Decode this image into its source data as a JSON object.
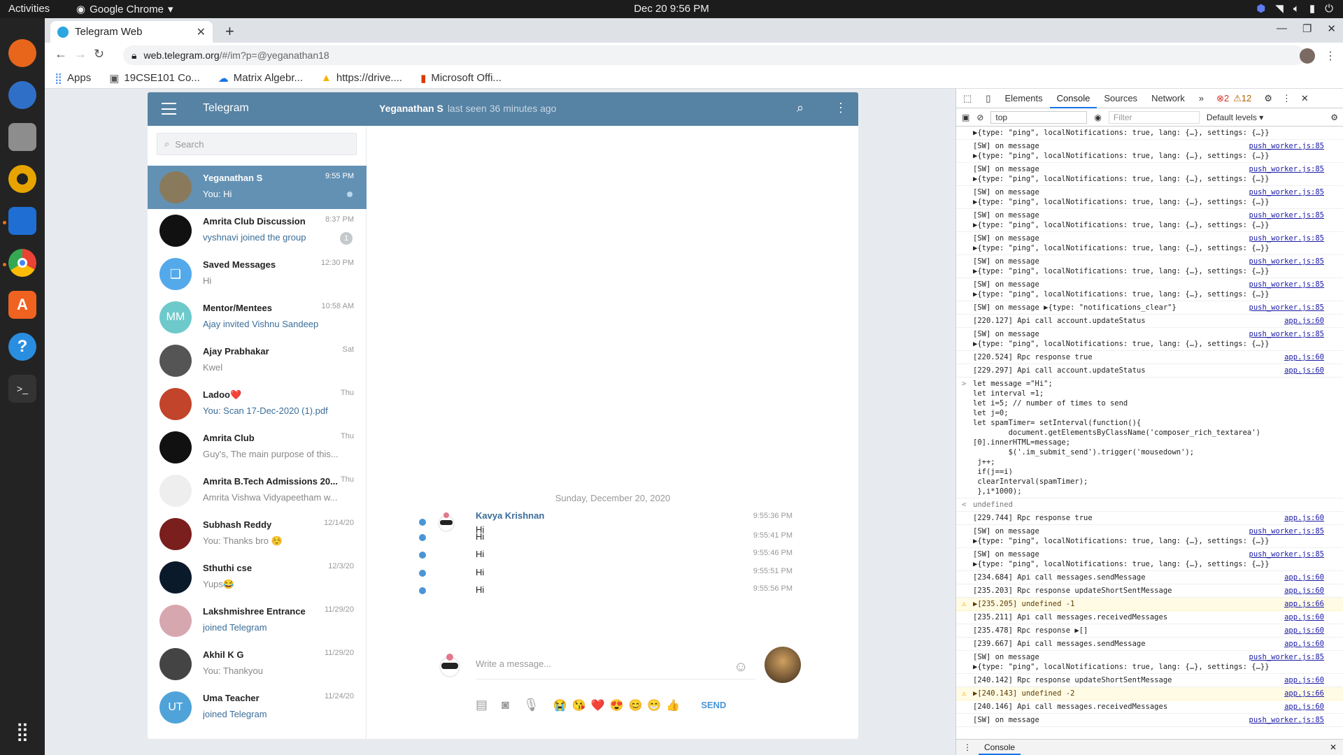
{
  "os": {
    "activities": "Activities",
    "app_name": "Google Chrome",
    "clock": "Dec 20  9:56 PM"
  },
  "dock": [
    "firefox-icon",
    "thunderbird-icon",
    "files-icon",
    "rhythmbox-icon",
    "writer-icon",
    "chrome-icon",
    "software-icon",
    "help-icon",
    "terminal-icon",
    "app-grid-icon"
  ],
  "browser": {
    "tab_title": "Telegram Web",
    "url_host": "web.telegram.org",
    "url_path": "/#/im?p=@yeganathan18",
    "bookmarks": [
      "Apps",
      "19CSE101 Co...",
      "Matrix Algebr...",
      "https://drive....",
      "Microsoft Offi..."
    ]
  },
  "telegram": {
    "brand": "Telegram",
    "peer_name": "Yeganathan S",
    "peer_status": "last seen 36 minutes ago",
    "search_placeholder": "Search",
    "dialogs": [
      {
        "name": "Yeganathan S",
        "time": "9:55 PM",
        "msg": "You: Hi",
        "active": true
      },
      {
        "name": "Amrita Club Discussion",
        "time": "8:37 PM",
        "msg": "vyshnavi joined the group",
        "badge": "1",
        "blue": true
      },
      {
        "name": "Saved Messages",
        "time": "12:30 PM",
        "msg": "Hi"
      },
      {
        "name": "Mentor/Mentees",
        "time": "10:58 AM",
        "msg": "Ajay invited Vishnu Sandeep",
        "initials": "MM",
        "blue": true
      },
      {
        "name": "Ajay Prabhakar",
        "time": "Sat",
        "msg": "Kwel"
      },
      {
        "name": "Ladoo❤️",
        "time": "Thu",
        "msg": "You: Scan 17-Dec-2020 (1).pdf",
        "blue": true
      },
      {
        "name": "Amrita Club",
        "time": "Thu",
        "msg": "Guy's, The main purpose of this..."
      },
      {
        "name": "Amrita B.Tech Admissions 20...",
        "time": "Thu",
        "msg": "Amrita Vishwa Vidyapeetham w..."
      },
      {
        "name": "Subhash Reddy",
        "time": "12/14/20",
        "msg": "You: Thanks bro ☺️"
      },
      {
        "name": "Sthuthi cse",
        "time": "12/3/20",
        "msg": "Yups😂"
      },
      {
        "name": "Lakshmishree Entrance",
        "time": "11/29/20",
        "msg": "joined Telegram",
        "blue": true
      },
      {
        "name": "Akhil K G",
        "time": "11/29/20",
        "msg": "You: Thankyou"
      },
      {
        "name": "Uma Teacher",
        "time": "11/24/20",
        "msg": "joined Telegram",
        "initials": "UT",
        "blue": true
      }
    ],
    "date_separator": "Sunday, December 20, 2020",
    "author": "Kavya Krishnan",
    "messages": [
      {
        "text": "Hi",
        "time": "9:55:36 PM"
      },
      {
        "text": "Hi",
        "time": "9:55:41 PM"
      },
      {
        "text": "Hi",
        "time": "9:55:46 PM"
      },
      {
        "text": "Hi",
        "time": "9:55:51 PM"
      },
      {
        "text": "Hi",
        "time": "9:55:56 PM"
      }
    ],
    "composer_placeholder": "Write a message...",
    "send_label": "SEND",
    "quick_emojis": [
      "😭",
      "😘",
      "❤️",
      "😍",
      "😊",
      "😁",
      "👍"
    ]
  },
  "devtools": {
    "tabs": [
      "Elements",
      "Console",
      "Sources",
      "Network"
    ],
    "errors": "2",
    "warnings": "12",
    "context": "top",
    "filter_placeholder": "Filter",
    "levels": "Default levels",
    "bottom_tab": "Console",
    "lines": [
      {
        "t": "▶{type: \"ping\", localNotifications: true, lang: {…}, settings: {…}}"
      },
      {
        "t": "[SW] on message\n▶{type: \"ping\", localNotifications: true, lang: {…}, settings: {…}}",
        "src": "push_worker.js:85"
      },
      {
        "t": "[SW] on message\n▶{type: \"ping\", localNotifications: true, lang: {…}, settings: {…}}",
        "src": "push_worker.js:85"
      },
      {
        "t": "[SW] on message\n▶{type: \"ping\", localNotifications: true, lang: {…}, settings: {…}}",
        "src": "push_worker.js:85"
      },
      {
        "t": "[SW] on message\n▶{type: \"ping\", localNotifications: true, lang: {…}, settings: {…}}",
        "src": "push_worker.js:85"
      },
      {
        "t": "[SW] on message\n▶{type: \"ping\", localNotifications: true, lang: {…}, settings: {…}}",
        "src": "push_worker.js:85"
      },
      {
        "t": "[SW] on message\n▶{type: \"ping\", localNotifications: true, lang: {…}, settings: {…}}",
        "src": "push_worker.js:85"
      },
      {
        "t": "[SW] on message\n▶{type: \"ping\", localNotifications: true, lang: {…}, settings: {…}}",
        "src": "push_worker.js:85"
      },
      {
        "t": "[SW] on message ▶{type: \"notifications_clear\"}",
        "src": "push_worker.js:85"
      },
      {
        "t": "[220.127] Api call account.updateStatus",
        "src": "app.js:60"
      },
      {
        "t": "[SW] on message\n▶{type: \"ping\", localNotifications: true, lang: {…}, settings: {…}}",
        "src": "push_worker.js:85"
      },
      {
        "t": "[220.524] Rpc response true",
        "src": "app.js:60"
      },
      {
        "t": "[229.297] Api call account.updateStatus",
        "src": "app.js:60"
      },
      {
        "t": "let message =\"Hi\";\nlet interval =1;\nlet i=5; // number of times to send\nlet j=0;\nlet spamTimer= setInterval(function(){\n        document.getElementsByClassName('composer_rich_textarea')\n[0].innerHTML=message;\n        $('.im_submit_send').trigger('mousedown');\n j++;\n if(j==i)\n clearInterval(spamTimer);\n },i*1000);",
        "kind": "input"
      },
      {
        "t": "undefined",
        "kind": "result"
      },
      {
        "t": "[229.744] Rpc response true",
        "src": "app.js:60"
      },
      {
        "t": "[SW] on message\n▶{type: \"ping\", localNotifications: true, lang: {…}, settings: {…}}",
        "src": "push_worker.js:85"
      },
      {
        "t": "[SW] on message\n▶{type: \"ping\", localNotifications: true, lang: {…}, settings: {…}}",
        "src": "push_worker.js:85"
      },
      {
        "t": "[234.684] Api call messages.sendMessage",
        "src": "app.js:60"
      },
      {
        "t": "[235.203] Rpc response updateShortSentMessage",
        "src": "app.js:60"
      },
      {
        "t": "▶[235.205] undefined -1",
        "src": "app.js:66",
        "kind": "warn"
      },
      {
        "t": "[235.211] Api call messages.receivedMessages",
        "src": "app.js:60"
      },
      {
        "t": "[235.478] Rpc response ▶[]",
        "src": "app.js:60"
      },
      {
        "t": "[239.667] Api call messages.sendMessage",
        "src": "app.js:60"
      },
      {
        "t": "[SW] on message\n▶{type: \"ping\", localNotifications: true, lang: {…}, settings: {…}}",
        "src": "push_worker.js:85"
      },
      {
        "t": "[240.142] Rpc response updateShortSentMessage",
        "src": "app.js:60"
      },
      {
        "t": "▶[240.143] undefined -2",
        "src": "app.js:66",
        "kind": "warn"
      },
      {
        "t": "[240.146] Api call messages.receivedMessages",
        "src": "app.js:60"
      },
      {
        "t": "[SW] on message",
        "src": "push_worker.js:85"
      }
    ]
  }
}
